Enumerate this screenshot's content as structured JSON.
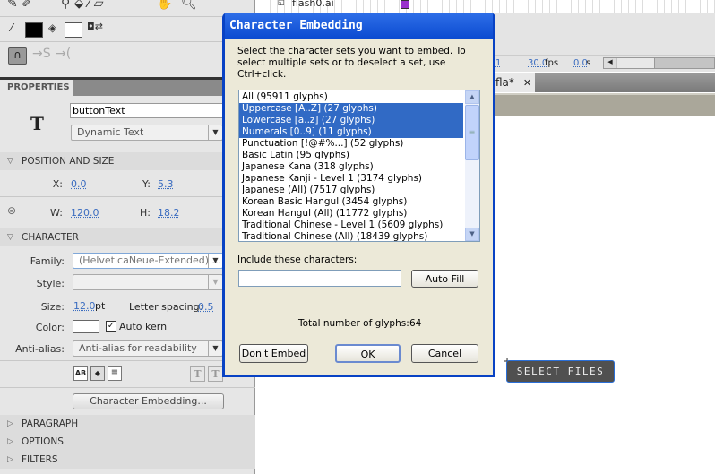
{
  "timeline": {
    "layer_name": "flash0.ai",
    "frame": "1",
    "fps": "30.0",
    "fps_unit": "fps",
    "time": "0.0",
    "time_unit": "s",
    "doc_tab": "fla*"
  },
  "properties": {
    "tab": "PROPERTIES",
    "instance_name": "buttonText",
    "text_type": "Dynamic Text",
    "position_size": {
      "header": "POSITION AND SIZE",
      "x_label": "X:",
      "x": "0.0",
      "y_label": "Y:",
      "y": "5.3",
      "w_label": "W:",
      "w": "120.0",
      "h_label": "H:",
      "h": "18.2"
    },
    "character": {
      "header": "CHARACTER",
      "family_label": "Family:",
      "family": "(HelveticaNeue-Extended) ...",
      "style_label": "Style:",
      "style": "",
      "size_label": "Size:",
      "size": "12.0",
      "size_unit": "pt",
      "spacing_label": "Letter spacing:",
      "spacing": "0.5",
      "color_label": "Color:",
      "color": "#ffffff",
      "autokern_label": "Auto kern",
      "autokern_checked": true,
      "antialias_label": "Anti-alias:",
      "antialias": "Anti-alias for readability",
      "embed_button": "Character Embedding..."
    },
    "collapsed_sections": [
      "PARAGRAPH",
      "OPTIONS",
      "FILTERS"
    ]
  },
  "dialog": {
    "title": "Character Embedding",
    "instructions": "Select the character sets you want to embed. To select multiple sets or to deselect a set, use Ctrl+click.",
    "sets": [
      {
        "label": "All  (95911 glyphs)",
        "selected": false
      },
      {
        "label": "Uppercase [A..Z]  (27 glyphs)",
        "selected": true
      },
      {
        "label": "Lowercase [a..z]  (27 glyphs)",
        "selected": true
      },
      {
        "label": "Numerals [0..9]  (11 glyphs)",
        "selected": true
      },
      {
        "label": "Punctuation [!@#%...]  (52 glyphs)",
        "selected": false
      },
      {
        "label": "Basic Latin  (95 glyphs)",
        "selected": false
      },
      {
        "label": "Japanese Kana  (318 glyphs)",
        "selected": false
      },
      {
        "label": "Japanese Kanji - Level 1 (3174 glyphs)",
        "selected": false
      },
      {
        "label": "Japanese (All)  (7517 glyphs)",
        "selected": false
      },
      {
        "label": "Korean Basic Hangul (3454 glyphs)",
        "selected": false
      },
      {
        "label": "Korean Hangul (All) (11772 glyphs)",
        "selected": false
      },
      {
        "label": "Traditional Chinese - Level 1 (5609 glyphs)",
        "selected": false
      },
      {
        "label": "Traditional Chinese (All)  (18439 glyphs)",
        "selected": false
      }
    ],
    "include_label": "Include these characters:",
    "include_value": "",
    "autofill": "Auto Fill",
    "total_label": "Total number of glyphs:",
    "total": "64",
    "dont_embed": "Don't Embed",
    "ok": "OK",
    "cancel": "Cancel"
  },
  "stage": {
    "button_label": "SELECT FILES"
  }
}
